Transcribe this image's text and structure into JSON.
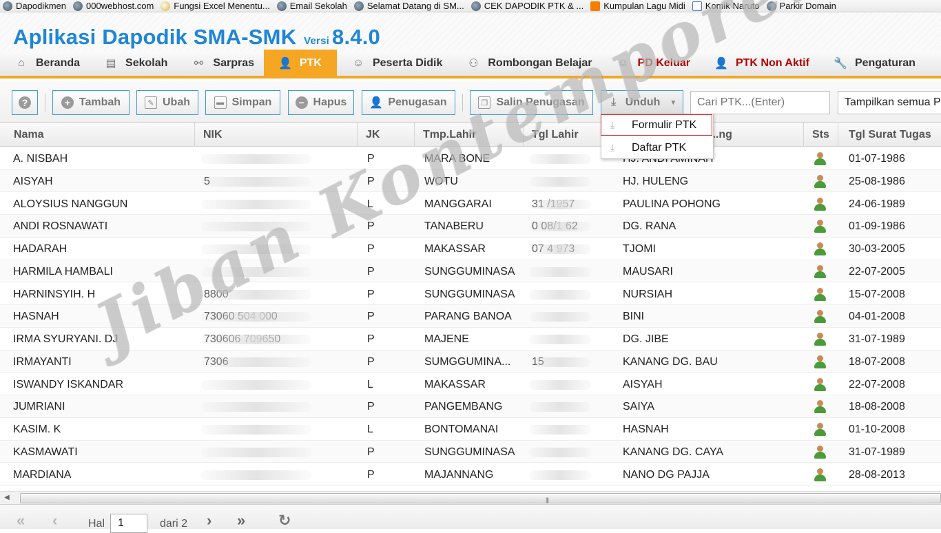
{
  "bookmarks": [
    {
      "label": "Dapodikmen",
      "icon": "globe-icon"
    },
    {
      "label": "000webhost.com",
      "icon": "globe-icon"
    },
    {
      "label": "Fungsi Excel Menentu...",
      "icon": "smiley-icon"
    },
    {
      "label": "Email Sekolah",
      "icon": "globe-icon"
    },
    {
      "label": "Selamat Datang di SM...",
      "icon": "globe-icon"
    },
    {
      "label": "CEK DAPODIK PTK & ...",
      "icon": "globe-icon"
    },
    {
      "label": "Kumpulan Lagu Midi",
      "icon": "blogger-icon"
    },
    {
      "label": "Komik Naruto",
      "icon": "gmail-icon"
    },
    {
      "label": "Parkir Domain",
      "icon": "globe-icon"
    }
  ],
  "header": {
    "title": "Aplikasi Dapodik SMA-SMK",
    "versi_label": "Versi",
    "version": "8.4.0",
    "title_color": "#1f86d6"
  },
  "nav": {
    "accent": "#f5a623",
    "items": [
      {
        "label": "Beranda",
        "icon": "home-icon"
      },
      {
        "label": "Sekolah",
        "icon": "document-icon"
      },
      {
        "label": "Sarpras",
        "icon": "binoculars-icon"
      },
      {
        "label": "PTK",
        "icon": "user-icon",
        "active": true
      },
      {
        "label": "Peserta Didik",
        "icon": "smiley-icon"
      },
      {
        "label": "Rombongan Belajar",
        "icon": "group-icon"
      },
      {
        "label": "PD Keluar",
        "icon": "smiley-icon",
        "color": "#b30000"
      },
      {
        "label": "PTK Non Aktif",
        "icon": "user-icon",
        "color": "#b30000"
      },
      {
        "label": "Pengaturan",
        "icon": "wrench-icon"
      }
    ]
  },
  "toolbar": {
    "help": "?",
    "tambah": "Tambah",
    "ubah": "Ubah",
    "simpan": "Simpan",
    "hapus": "Hapus",
    "penugasan": "Penugasan",
    "salin_penugasan": "Salin Penugasan",
    "unduh": "Unduh",
    "search_placeholder": "Cari PTK...(Enter)",
    "filter_value": "Tampilkan semua PTK"
  },
  "unduh_menu": {
    "items": [
      "Formulir PTK",
      "Daftar PTK"
    ]
  },
  "grid": {
    "columns": [
      "Nama",
      "NIK",
      "JK",
      "Tmp.Lahir",
      "Tgl Lahir",
      "...ng",
      "Sts",
      "Tgl Surat Tugas"
    ],
    "rows": [
      {
        "nama": "A. NISBAH",
        "nik": "",
        "jk": "P",
        "tmp": "MARA BONE",
        "tgl": "",
        "ibu": "HJ. ANDI AMINAH",
        "tst": "01-07-1986"
      },
      {
        "nama": "AISYAH",
        "nik": "5",
        "jk": "P",
        "tmp": "WOTU",
        "tgl": "",
        "ibu": "HJ. HULENG",
        "tst": "25-08-1986"
      },
      {
        "nama": "ALOYSIUS NANGGUN",
        "nik": "",
        "jk": "L",
        "tmp": "MANGGARAI",
        "tgl": "31 /1957",
        "ibu": "PAULINA POHONG",
        "tst": "24-06-1989"
      },
      {
        "nama": "ANDI ROSNAWATI",
        "nik": "",
        "jk": "P",
        "tmp": "TANABERU",
        "tgl": "0 08/1 62",
        "ibu": "DG. RANA",
        "tst": "01-09-1986"
      },
      {
        "nama": "HADARAH",
        "nik": "",
        "jk": "P",
        "tmp": "MAKASSAR",
        "tgl": "07 4 973",
        "ibu": "TJOMI",
        "tst": "30-03-2005"
      },
      {
        "nama": "HARMILA HAMBALI",
        "nik": "",
        "jk": "P",
        "tmp": "SUNGGUMINASA",
        "tgl": "",
        "ibu": "MAUSARI",
        "tst": "22-07-2005"
      },
      {
        "nama": "HARNINSYIH. H",
        "nik": "8800",
        "jk": "P",
        "tmp": "SUNGGUMINASA",
        "tgl": "",
        "ibu": "NURSIAH",
        "tst": "15-07-2008"
      },
      {
        "nama": "HASNAH",
        "nik": "73060 504 000",
        "jk": "P",
        "tmp": "PARANG BANOA",
        "tgl": "",
        "ibu": "BINI",
        "tst": "04-01-2008"
      },
      {
        "nama": "IRMA SYURYANI. DJ",
        "nik": "730606 709650",
        "jk": "P",
        "tmp": "MAJENE",
        "tgl": "",
        "ibu": "DG. JIBE",
        "tst": "31-07-1989"
      },
      {
        "nama": "IRMAYANTI",
        "nik": "7306",
        "jk": "P",
        "tmp": "SUMGGUMINA...",
        "tgl": "15",
        "ibu": "KANANG DG. BAU",
        "tst": "18-07-2008"
      },
      {
        "nama": "ISWANDY ISKANDAR",
        "nik": "",
        "jk": "L",
        "tmp": "MAKASSAR",
        "tgl": "",
        "ibu": "AISYAH",
        "tst": "22-07-2008"
      },
      {
        "nama": "JUMRIANI",
        "nik": "",
        "jk": "P",
        "tmp": "PANGEMBANG",
        "tgl": "",
        "ibu": "SAIYA",
        "tst": "18-08-2008"
      },
      {
        "nama": "KASIM. K",
        "nik": "",
        "jk": "L",
        "tmp": "BONTOMANAI",
        "tgl": "",
        "ibu": "HASNAH",
        "tst": "01-10-2008"
      },
      {
        "nama": "KASMAWATI",
        "nik": "",
        "jk": "P",
        "tmp": "SUNGGUMINASA",
        "tgl": "",
        "ibu": "KANANG DG. CAYA",
        "tst": "31-07-1989"
      },
      {
        "nama": "MARDIANA",
        "nik": "",
        "jk": "P",
        "tmp": "MAJANNANG",
        "tgl": "",
        "ibu": "NANO DG PAJJA",
        "tst": "28-08-2013"
      }
    ]
  },
  "paging": {
    "hal_label": "Hal",
    "page": "1",
    "dari_label": "dari 2"
  },
  "watermark": "Jiban Kontemporer"
}
